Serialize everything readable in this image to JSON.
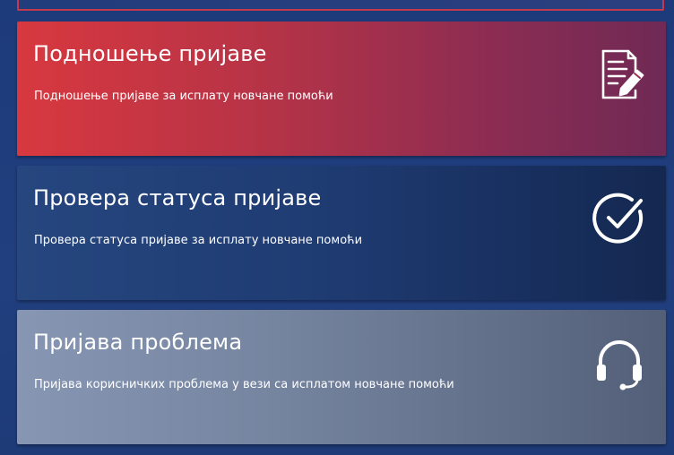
{
  "cards": [
    {
      "title": "Подношење пријаве",
      "description": "Подношење пријаве за исплату новчане помоћи",
      "icon": "document-pen-icon"
    },
    {
      "title": "Провера статуса пријаве",
      "description": "Провера статуса пријаве за исплату новчане помоћи",
      "icon": "check-circle-icon"
    },
    {
      "title": "Пријава проблема",
      "description": "Пријава корисничких проблема у вези са исплатом новчане помоћи",
      "icon": "headset-icon"
    }
  ],
  "colors": {
    "page_background": "#1e3a78",
    "card_submit_start": "#d8383f",
    "card_submit_end": "#6f2a55",
    "card_status_start": "#26467f",
    "card_status_end": "#142850",
    "card_report_start": "#8796b3",
    "card_report_end": "#535f78",
    "text": "#ffffff"
  }
}
